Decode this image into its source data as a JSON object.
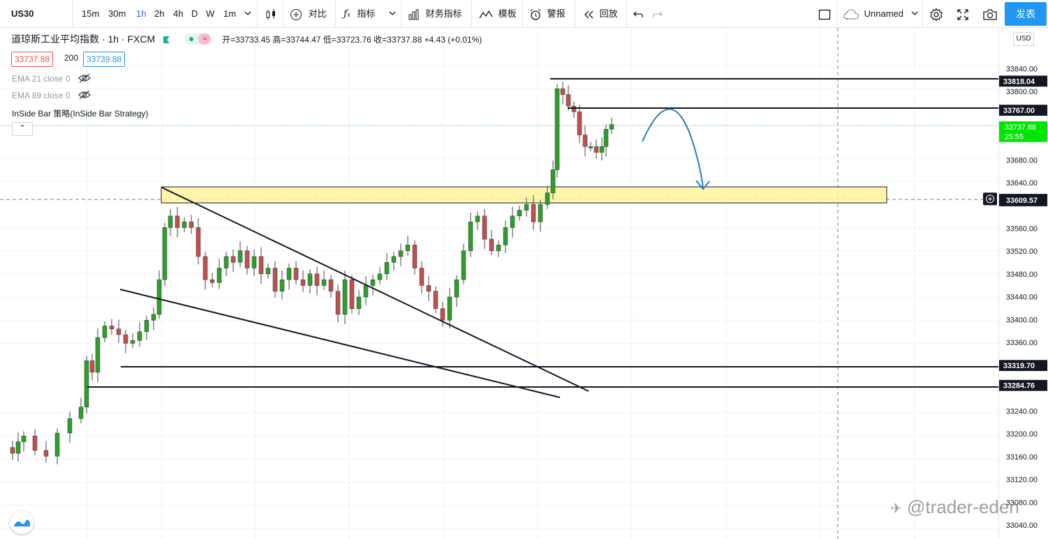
{
  "toolbar": {
    "symbol": "US30",
    "intervals": [
      "15m",
      "30m",
      "1h",
      "2h",
      "4h",
      "D",
      "W",
      "1m"
    ],
    "active_interval": "1h",
    "compare": "对比",
    "indicators": "指标",
    "financials": "财务指标",
    "templates": "模板",
    "alert": "警报",
    "replay": "回放",
    "layout_name": "Unnamed",
    "publish": "发表"
  },
  "legend": {
    "title": "道琼斯工业平均指数 · 1h · FXCM",
    "ohlc": "开=33733.45 高=33744.47 低=33723.76 收=33737.88 +4.43 (+0.01%)",
    "bid": "33737.88",
    "spread": "200",
    "ask": "33739.88",
    "ema21": "EMA 21 close 0",
    "ema89": "EMA 89 close 0",
    "strategy": "InSide Bar 策略(InSide Bar Strategy)",
    "collapse": "⌃"
  },
  "axis": {
    "currency": "USD",
    "ticks": [
      "33840.00",
      "33800.00",
      "33680.00",
      "33640.00",
      "33560.00",
      "33520.00",
      "33480.00",
      "33440.00",
      "33400.00",
      "33360.00",
      "33240.00",
      "33200.00",
      "33160.00",
      "33120.00",
      "33080.00",
      "33040.00"
    ],
    "level_labels": [
      "33818.04",
      "33767.00",
      "33319.70",
      "33284.76"
    ],
    "current_price": "33737.88",
    "countdown": "25:55",
    "crosshair_price": "33609.57"
  },
  "colors": {
    "up": "#26a69a",
    "down": "#ef5350",
    "up_candle": "#2ca02c",
    "down_candle": "#c0504d",
    "zone_fill": "#fff59d",
    "accent": "#2962ff",
    "publish": "#2196f3",
    "arrow": "#2a7bbd"
  },
  "watermark": "@trader-eden"
}
